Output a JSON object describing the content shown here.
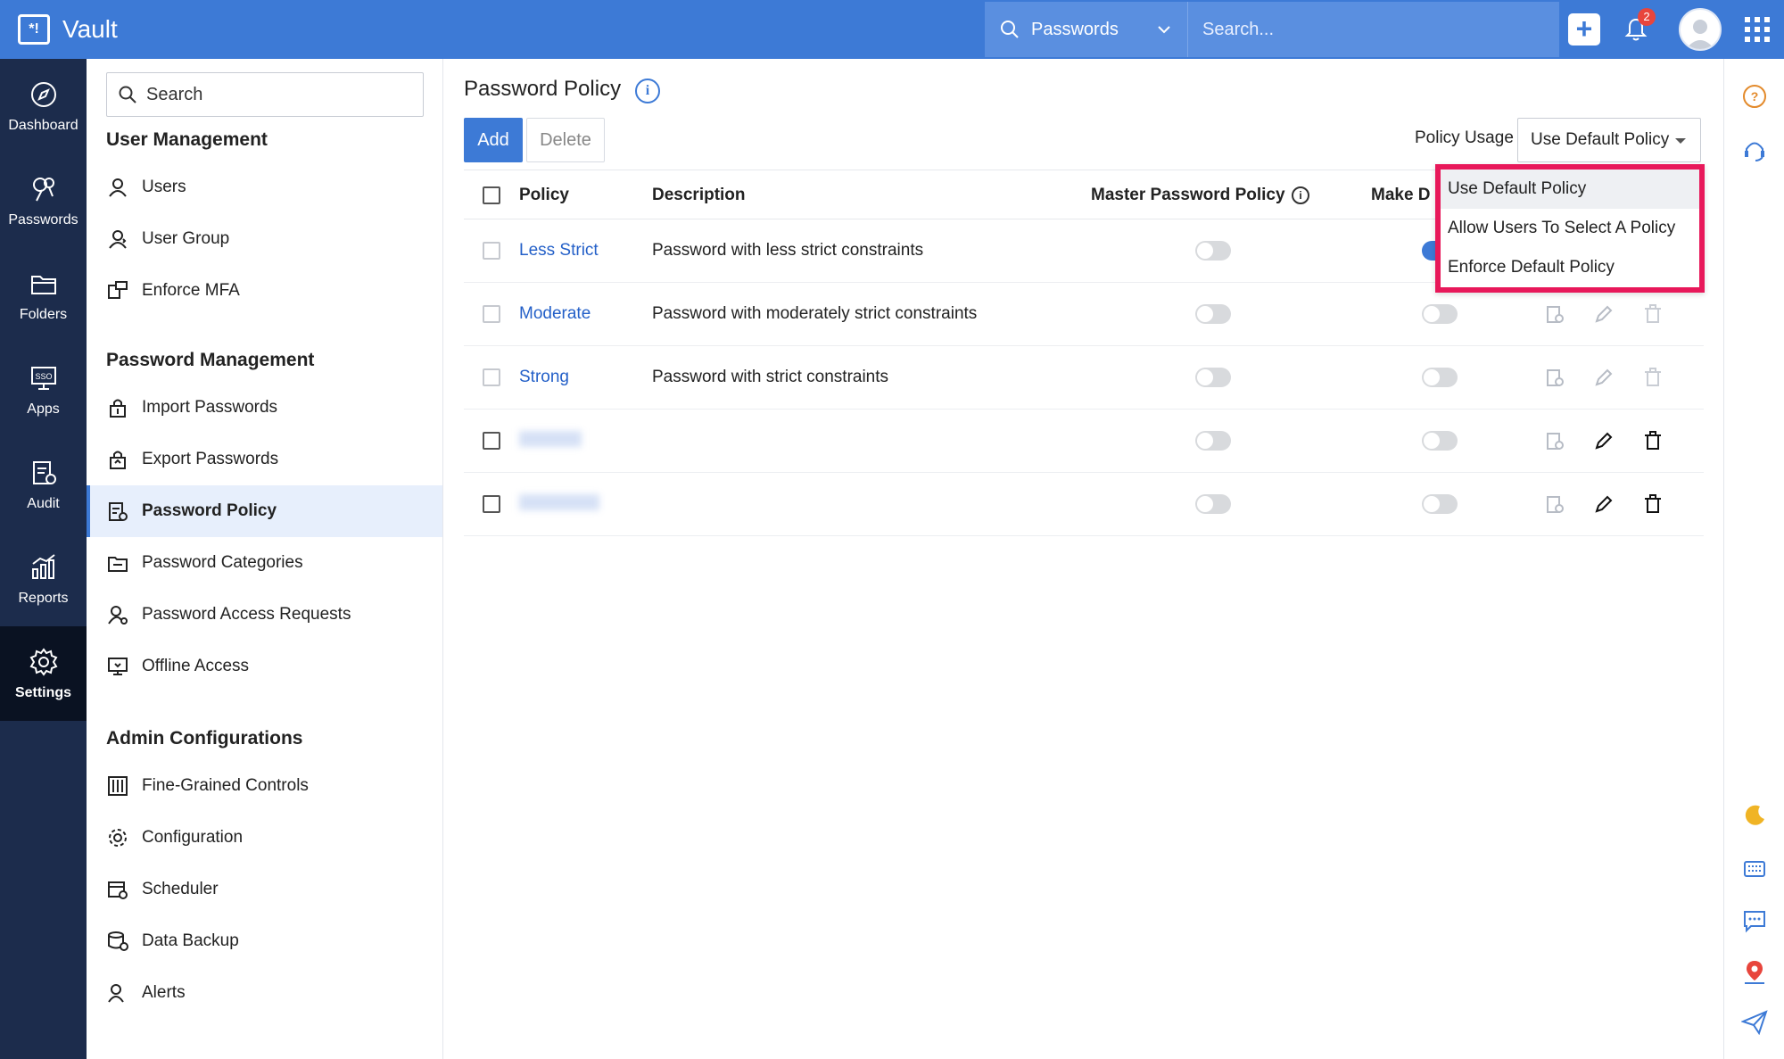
{
  "app": {
    "name": "Vault"
  },
  "topbar": {
    "search_scope": "Passwords",
    "search_placeholder": "Search...",
    "notification_count": "2"
  },
  "rail": {
    "items": [
      {
        "label": "Dashboard",
        "icon": "compass-icon"
      },
      {
        "label": "Passwords",
        "icon": "keys-icon"
      },
      {
        "label": "Folders",
        "icon": "folder-icon"
      },
      {
        "label": "Apps",
        "icon": "sso-icon"
      },
      {
        "label": "Audit",
        "icon": "audit-icon"
      },
      {
        "label": "Reports",
        "icon": "reports-icon"
      },
      {
        "label": "Settings",
        "icon": "gear-icon",
        "active": true
      }
    ]
  },
  "settings": {
    "search_placeholder": "Search",
    "sections": {
      "user_management": "User Management",
      "password_management": "Password Management",
      "admin_configurations": "Admin Configurations"
    },
    "items": {
      "users": "Users",
      "user_group": "User Group",
      "enforce_mfa": "Enforce MFA",
      "import_passwords": "Import Passwords",
      "export_passwords": "Export Passwords",
      "password_policy": "Password Policy",
      "password_categories": "Password Categories",
      "password_access_requests": "Password Access Requests",
      "offline_access": "Offline Access",
      "fine_grained_controls": "Fine-Grained Controls",
      "configuration": "Configuration",
      "scheduler": "Scheduler",
      "data_backup": "Data Backup",
      "alerts": "Alerts"
    }
  },
  "main": {
    "title": "Password Policy",
    "add_label": "Add",
    "delete_label": "Delete",
    "policy_usage_label": "Policy Usage",
    "policy_usage_value": "Use Default Policy",
    "columns": {
      "policy": "Policy",
      "description": "Description",
      "master_password_policy": "Master Password Policy",
      "make_default": "Make D"
    },
    "rows": [
      {
        "name": "Less Strict",
        "description": "Password with less strict constraints",
        "master": false,
        "default": true
      },
      {
        "name": "Moderate",
        "description": "Password with moderately strict constraints",
        "master": false,
        "default": false
      },
      {
        "name": "Strong",
        "description": "Password with strict constraints",
        "master": false,
        "default": false
      },
      {
        "name": "",
        "description": "",
        "master": false,
        "default": false
      },
      {
        "name": "",
        "description": "",
        "master": false,
        "default": false
      }
    ]
  },
  "dropdown": {
    "options": [
      "Use Default Policy",
      "Allow Users To Select A Policy",
      "Enforce Default Policy"
    ],
    "selected": "Use Default Policy",
    "highlight_color": "#e8185a"
  },
  "colors": {
    "primary": "#3d7ad6",
    "rail": "#1c2c4c",
    "link": "#2460c8"
  }
}
